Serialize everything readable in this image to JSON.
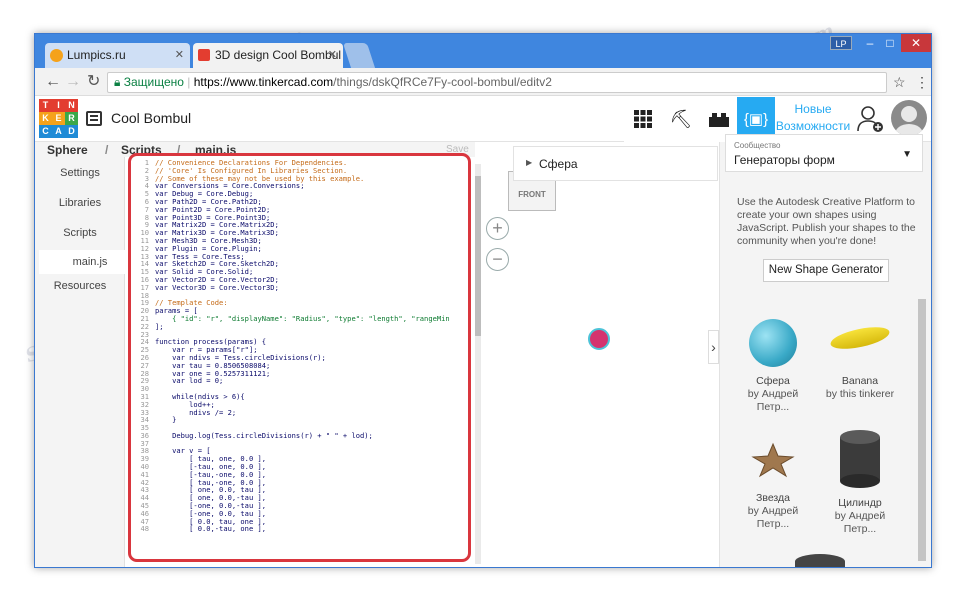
{
  "browser": {
    "tabs": [
      {
        "label": "Lumpics.ru",
        "active": false
      },
      {
        "label": "3D design Cool Bombul |",
        "active": true
      }
    ],
    "profile_badge": "LP",
    "window_controls": [
      "–",
      "□",
      "✕"
    ],
    "address": {
      "secure_label": "Защищено",
      "url_domain": "https://www.tinkercad.com",
      "url_path": "/things/dskQfRCe7Fy-cool-bombul/editv2"
    }
  },
  "app": {
    "logo_letters": [
      "T",
      "I",
      "N",
      "K",
      "E",
      "R",
      "C",
      "A",
      "D"
    ],
    "design_name": "Cool Bombul",
    "new_features_label_1": "Новые",
    "new_features_label_2": "Возможности",
    "colors": {
      "accent": "#26aaf2",
      "logo_red": "#e33d30",
      "logo_orange": "#f5a21b",
      "logo_green": "#3aa849",
      "logo_blue": "#1f8bd6"
    }
  },
  "breadcrumb": {
    "root": "Sphere",
    "level1": "Scripts",
    "file": "main.js",
    "save_label": "Save"
  },
  "sidebar": {
    "items": [
      {
        "label": "Settings"
      },
      {
        "label": "Libraries"
      },
      {
        "label": "Scripts"
      },
      {
        "label": "main.js"
      },
      {
        "label": "Resources"
      }
    ]
  },
  "code_lines": [
    {
      "n": "1",
      "t": "// Convenience Declarations For Dependencies.",
      "cls": "c"
    },
    {
      "n": "2",
      "t": "// 'Core' Is Configured In Libraries Section.",
      "cls": "c"
    },
    {
      "n": "3",
      "t": "// Some of these may not be used by this example.",
      "cls": "c"
    },
    {
      "n": "4",
      "t": "var Conversions = Core.Conversions;",
      "cls": ""
    },
    {
      "n": "5",
      "t": "var Debug = Core.Debug;",
      "cls": ""
    },
    {
      "n": "6",
      "t": "var Path2D = Core.Path2D;",
      "cls": ""
    },
    {
      "n": "7",
      "t": "var Point2D = Core.Point2D;",
      "cls": ""
    },
    {
      "n": "8",
      "t": "var Point3D = Core.Point3D;",
      "cls": ""
    },
    {
      "n": "9",
      "t": "var Matrix2D = Core.Matrix2D;",
      "cls": ""
    },
    {
      "n": "10",
      "t": "var Matrix3D = Core.Matrix3D;",
      "cls": ""
    },
    {
      "n": "11",
      "t": "var Mesh3D = Core.Mesh3D;",
      "cls": ""
    },
    {
      "n": "12",
      "t": "var Plugin = Core.Plugin;",
      "cls": ""
    },
    {
      "n": "13",
      "t": "var Tess = Core.Tess;",
      "cls": ""
    },
    {
      "n": "14",
      "t": "var Sketch2D = Core.Sketch2D;",
      "cls": ""
    },
    {
      "n": "15",
      "t": "var Solid = Core.Solid;",
      "cls": ""
    },
    {
      "n": "16",
      "t": "var Vector2D = Core.Vector2D;",
      "cls": ""
    },
    {
      "n": "17",
      "t": "var Vector3D = Core.Vector3D;",
      "cls": ""
    },
    {
      "n": "18",
      "t": "",
      "cls": ""
    },
    {
      "n": "19",
      "t": "// Template Code:",
      "cls": "c"
    },
    {
      "n": "20",
      "t": "params = [",
      "cls": ""
    },
    {
      "n": "21",
      "t": "    { \"id\": \"r\", \"displayName\": \"Radius\", \"type\": \"length\", \"rangeMin",
      "cls": "s"
    },
    {
      "n": "22",
      "t": "];",
      "cls": ""
    },
    {
      "n": "23",
      "t": "",
      "cls": ""
    },
    {
      "n": "24",
      "t": "function process(params) {",
      "cls": ""
    },
    {
      "n": "25",
      "t": "    var r = params[\"r\"];",
      "cls": ""
    },
    {
      "n": "26",
      "t": "    var ndivs = Tess.circleDivisions(r);",
      "cls": ""
    },
    {
      "n": "27",
      "t": "    var tau = 0.8506508084;",
      "cls": ""
    },
    {
      "n": "28",
      "t": "    var one = 0.5257311121;",
      "cls": ""
    },
    {
      "n": "29",
      "t": "    var lod = 0;",
      "cls": ""
    },
    {
      "n": "30",
      "t": "",
      "cls": ""
    },
    {
      "n": "31",
      "t": "    while(ndivs > 6){",
      "cls": ""
    },
    {
      "n": "32",
      "t": "        lod++;",
      "cls": ""
    },
    {
      "n": "33",
      "t": "        ndivs /= 2;",
      "cls": ""
    },
    {
      "n": "34",
      "t": "    }",
      "cls": ""
    },
    {
      "n": "35",
      "t": "",
      "cls": ""
    },
    {
      "n": "36",
      "t": "    Debug.log(Tess.circleDivisions(r) + \" \" + lod);",
      "cls": ""
    },
    {
      "n": "37",
      "t": "",
      "cls": ""
    },
    {
      "n": "38",
      "t": "    var v = [",
      "cls": ""
    },
    {
      "n": "39",
      "t": "        [ tau, one, 0.0 ],",
      "cls": ""
    },
    {
      "n": "40",
      "t": "        [-tau, one, 0.0 ],",
      "cls": ""
    },
    {
      "n": "41",
      "t": "        [-tau,-one, 0.0 ],",
      "cls": ""
    },
    {
      "n": "42",
      "t": "        [ tau,-one, 0.0 ],",
      "cls": ""
    },
    {
      "n": "43",
      "t": "        [ one, 0.0, tau ],",
      "cls": ""
    },
    {
      "n": "44",
      "t": "        [ one, 0.0,-tau ],",
      "cls": ""
    },
    {
      "n": "45",
      "t": "        [-one, 0.0,-tau ],",
      "cls": ""
    },
    {
      "n": "46",
      "t": "        [-one, 0.0, tau ],",
      "cls": ""
    },
    {
      "n": "47",
      "t": "        [ 0.0, tau, one ],",
      "cls": ""
    },
    {
      "n": "48",
      "t": "        [ 0.0,-tau, one ],",
      "cls": ""
    }
  ],
  "viewport": {
    "view_cube_label": "FRONT",
    "shape_name": "Сфера",
    "zoom_in": "+",
    "zoom_out": "−"
  },
  "panel": {
    "dropdown_caption": "Сообщество",
    "dropdown_value": "Генераторы форм",
    "description": "Use the Autodesk Creative Platform to create your own shapes using JavaScript. Publish your shapes to the community when you're done!",
    "generator_button": "New Shape Generator",
    "shapes": [
      {
        "name": "Сфера",
        "author": "by Андрей Петр..."
      },
      {
        "name": "Banana",
        "author": "by this tinkerer"
      },
      {
        "name": "Звезда",
        "author": "by Андрей Петр..."
      },
      {
        "name": "Цилиндр",
        "author": "by Андрей Петр..."
      }
    ]
  },
  "watermark": "Soringpcrepair.com"
}
